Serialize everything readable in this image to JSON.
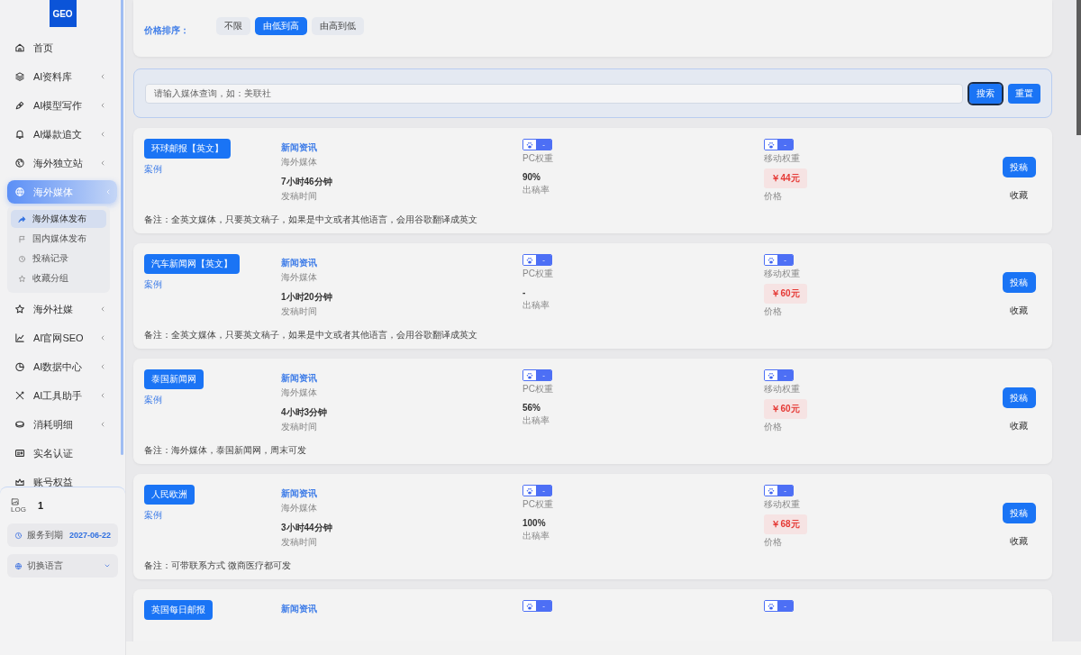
{
  "logo": "GEO",
  "nav": [
    {
      "label": "首页",
      "expandable": false,
      "selected": false
    },
    {
      "label": "AI资料库",
      "expandable": true,
      "selected": false
    },
    {
      "label": "AI模型写作",
      "expandable": true,
      "selected": false
    },
    {
      "label": "AI爆款追文",
      "expandable": true,
      "selected": false
    },
    {
      "label": "海外独立站",
      "expandable": true,
      "selected": false
    },
    {
      "label": "海外媒体",
      "expandable": true,
      "selected": true,
      "children": [
        {
          "label": "海外媒体发布",
          "selected": true
        },
        {
          "label": "国内媒体发布",
          "selected": false
        },
        {
          "label": "投稿记录",
          "selected": false
        },
        {
          "label": "收藏分组",
          "selected": false
        }
      ]
    },
    {
      "label": "海外社媒",
      "expandable": true,
      "selected": false
    },
    {
      "label": "AI官网SEO",
      "expandable": true,
      "selected": false
    },
    {
      "label": "AI数据中心",
      "expandable": true,
      "selected": false
    },
    {
      "label": "AI工具助手",
      "expandable": true,
      "selected": false
    },
    {
      "label": "消耗明细",
      "expandable": true,
      "selected": false
    },
    {
      "label": "实名认证",
      "expandable": false,
      "selected": false
    },
    {
      "label": "账号权益",
      "expandable": false,
      "selected": false
    }
  ],
  "sidebar_footer": {
    "logo_alt": "LOG",
    "user": "1",
    "expiry_label": "服务到期",
    "expiry_date": "2027-06-22",
    "language": "切换语言",
    "expanded": false
  },
  "filter": {
    "label": "价格排序：",
    "options": [
      {
        "label": "不限",
        "selected": false
      },
      {
        "label": "由低到高",
        "selected": true
      },
      {
        "label": "由高到低",
        "selected": false
      }
    ]
  },
  "search": {
    "placeholder": "请输入媒体查询，如：美联社",
    "buttons": [
      "搜索",
      "重置"
    ]
  },
  "media": [
    {
      "name": "环球邮报【英文】",
      "case_link": "案例",
      "category": "新闻资讯",
      "type": "海外媒体",
      "time": "7小时46分钟",
      "time_label": "发稿时间",
      "pc_weight": "-",
      "pc_label": "PC权重",
      "rate": "90%",
      "rate_label": "出稿率",
      "mobile_weight": "-",
      "mobile_label": "移动权重",
      "price": "￥44元",
      "price_label": "价格",
      "submit": "投稿",
      "favorite": "收藏",
      "note": "备注：全英文媒体，只要英文稿子，如果是中文或者其他语言，会用谷歌翻译成英文"
    },
    {
      "name": "汽车新闻网【英文】",
      "case_link": "案例",
      "category": "新闻资讯",
      "type": "海外媒体",
      "time": "1小时20分钟",
      "time_label": "发稿时间",
      "pc_weight": "-",
      "pc_label": "PC权重",
      "rate": "-",
      "rate_label": "出稿率",
      "mobile_weight": "-",
      "mobile_label": "移动权重",
      "price": "￥60元",
      "price_label": "价格",
      "submit": "投稿",
      "favorite": "收藏",
      "note": "备注：全英文媒体，只要英文稿子，如果是中文或者其他语言，会用谷歌翻译成英文"
    },
    {
      "name": "泰国新闻网",
      "case_link": "案例",
      "category": "新闻资讯",
      "type": "海外媒体",
      "time": "4小时3分钟",
      "time_label": "发稿时间",
      "pc_weight": "-",
      "pc_label": "PC权重",
      "rate": "56%",
      "rate_label": "出稿率",
      "mobile_weight": "-",
      "mobile_label": "移动权重",
      "price": "￥60元",
      "price_label": "价格",
      "submit": "投稿",
      "favorite": "收藏",
      "note": "备注：海外媒体，泰国新闻网，周末可发"
    },
    {
      "name": "人民欧洲",
      "case_link": "案例",
      "category": "新闻资讯",
      "type": "海外媒体",
      "time": "3小时44分钟",
      "time_label": "发稿时间",
      "pc_weight": "-",
      "pc_label": "PC权重",
      "rate": "100%",
      "rate_label": "出稿率",
      "mobile_weight": "-",
      "mobile_label": "移动权重",
      "price": "￥68元",
      "price_label": "价格",
      "submit": "投稿",
      "favorite": "收藏",
      "note": "备注：可带联系方式 微商医疗都可发"
    },
    {
      "name": "英国每日邮报",
      "category": "新闻资讯",
      "pc_weight": "-",
      "mobile_weight": "-"
    }
  ]
}
